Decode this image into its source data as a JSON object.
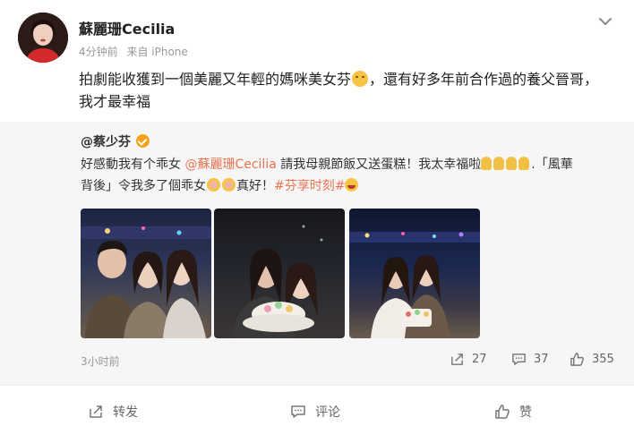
{
  "post": {
    "author": "蘇麗珊Cecilia",
    "time": "4分钟前",
    "source": "来自 iPhone",
    "text_part1": "拍劇能收獲到一個美麗又年輕的媽咪美女芬",
    "text_part2": "，還有好多年前合作過的養父晉哥，我才最幸福",
    "trailing_chars": "   "
  },
  "repost": {
    "author": "@蔡少芬",
    "text_part1": "好感動",
    "text_part2": "我有个乖女 ",
    "mention": "@蘇麗珊Cecilia",
    "text_part3": " 請我母親節飯又送蛋糕！我太幸福啦",
    "text_part4": ".「風華背後」令我多了個乖女",
    "text_part5": "真好！",
    "hashtag": "#芬享时刻#",
    "time": "3小时前",
    "stats": {
      "reposts": "27",
      "comments": "37",
      "likes": "355"
    }
  },
  "actions": {
    "repost_label": "转发",
    "comment_label": "评论",
    "like_label": "赞"
  },
  "icons": {
    "more": "chevron-down-icon",
    "repost": "share-icon",
    "comment": "comment-icon",
    "like": "thumbs-up-icon"
  },
  "colors": {
    "link": "#eb7350",
    "repost_bg": "#f6f6f6",
    "verified": "#f7a11a"
  }
}
